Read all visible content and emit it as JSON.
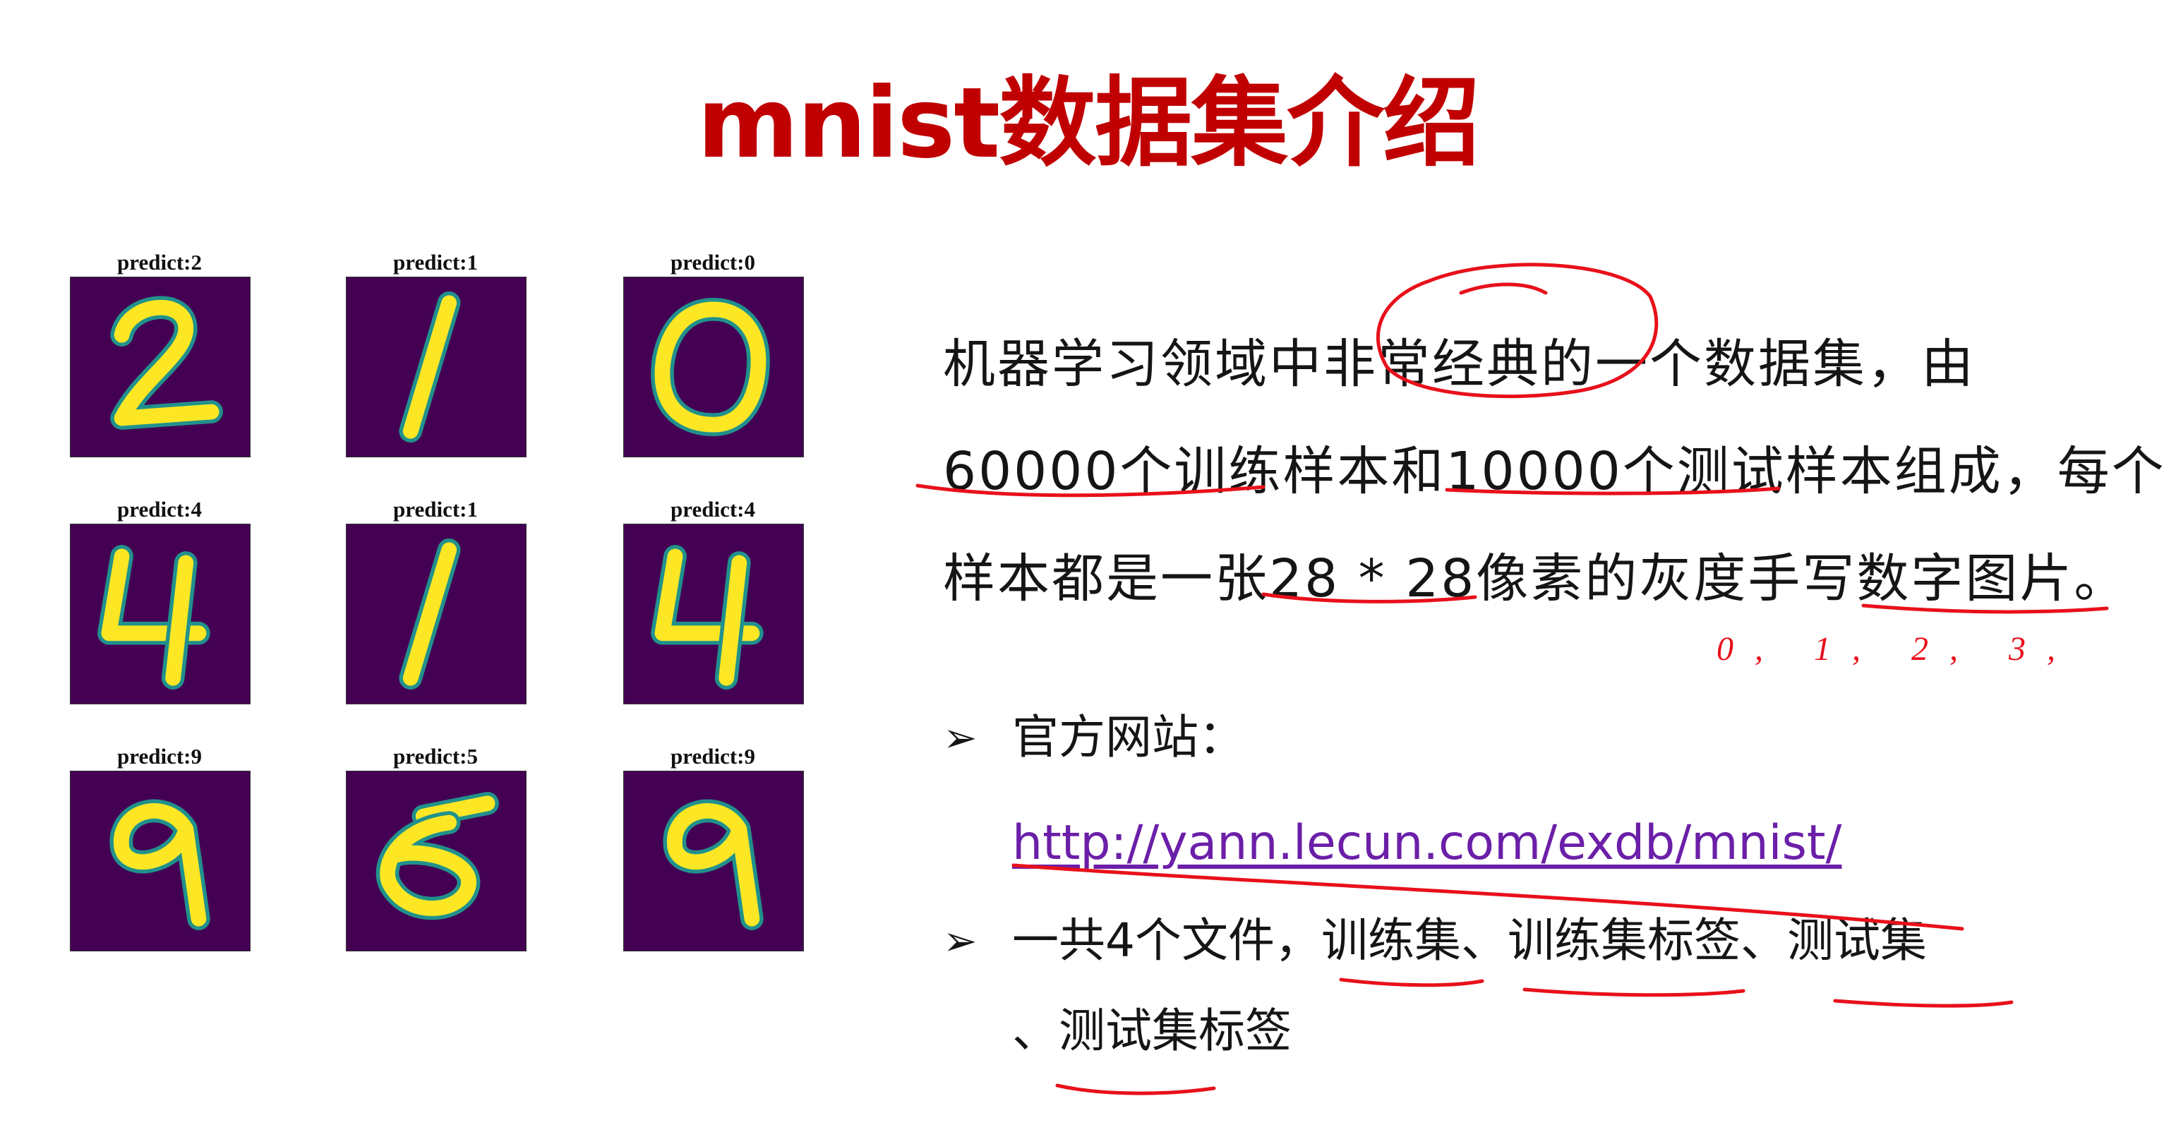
{
  "slide": {
    "title": "mnist数据集介绍",
    "samples": [
      {
        "label": "predict:2",
        "digit": "2"
      },
      {
        "label": "predict:1",
        "digit": "1"
      },
      {
        "label": "predict:0",
        "digit": "0"
      },
      {
        "label": "predict:4",
        "digit": "4"
      },
      {
        "label": "predict:1",
        "digit": "1"
      },
      {
        "label": "predict:4",
        "digit": "4"
      },
      {
        "label": "predict:9",
        "digit": "9"
      },
      {
        "label": "predict:5",
        "digit": "5"
      },
      {
        "label": "predict:9",
        "digit": "9"
      }
    ],
    "paragraph": [
      "机器学习领域中非常经典的一个数据集，由",
      "60000个训练样本和10000个测试样本组成，每个",
      "样本都是一张28 * 28像素的灰度手写数字图片。"
    ],
    "bullets": [
      {
        "mark": "➢",
        "label": "官方网站：",
        "link": "http://yann.lecun.com/exdb/mnist/"
      },
      {
        "mark": "➢",
        "text": "一共4个文件，训练集、训练集标签、测试集",
        "continuation": "、测试集标签"
      }
    ],
    "annotation": "0,  1,  2,  3,"
  },
  "colors": {
    "title": "#c00000",
    "ink": "#e8101a",
    "link": "#6b1fa8",
    "viridis_dark": "#440154",
    "viridis_light": "#fde725",
    "viridis_mid": "#21918c"
  }
}
